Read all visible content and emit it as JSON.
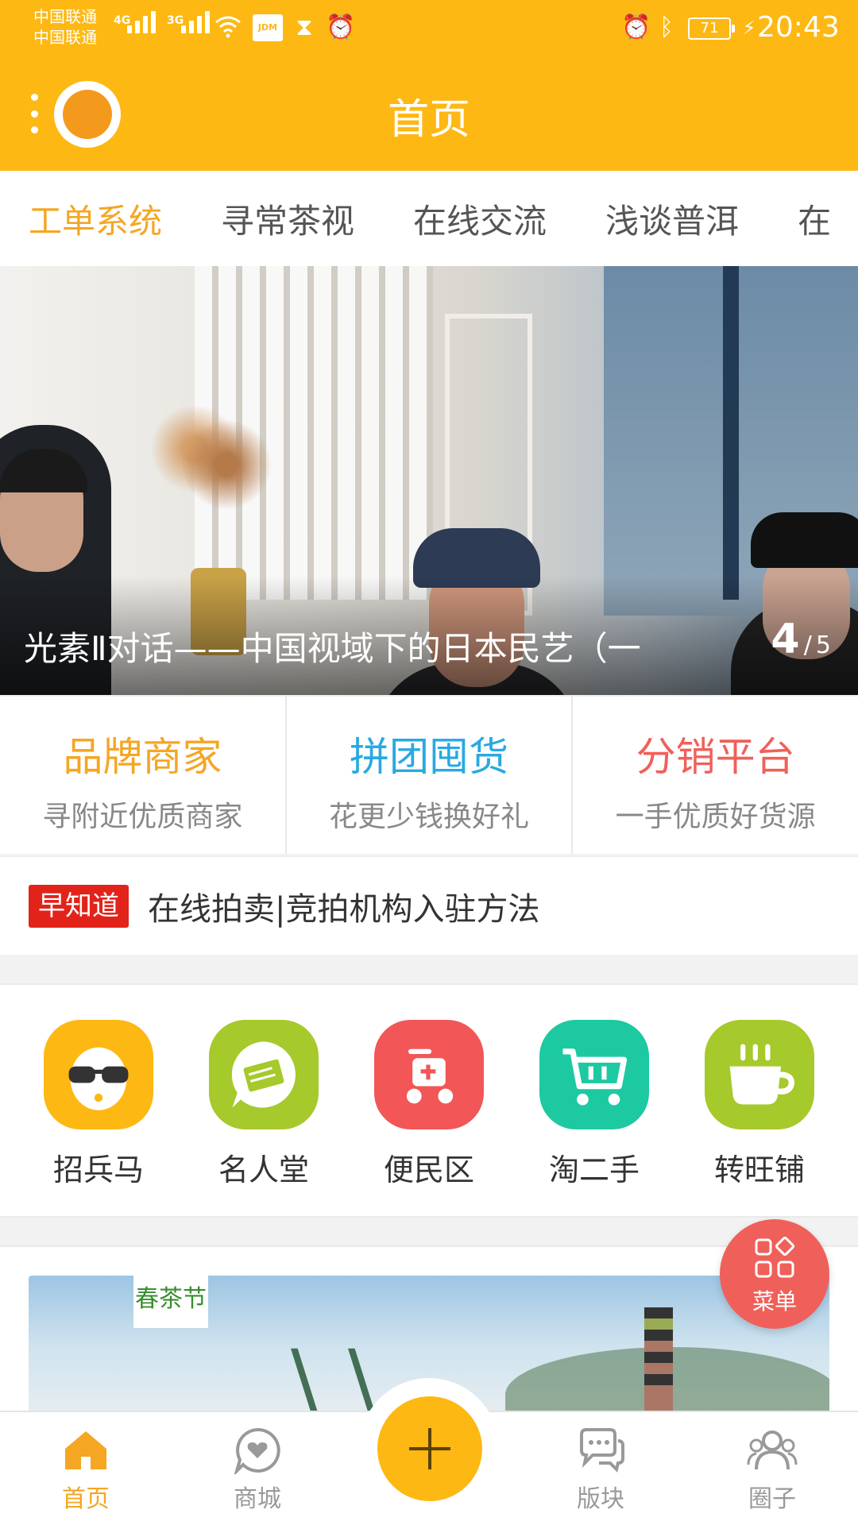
{
  "status_bar": {
    "carrier1": "中国联通",
    "carrier2": "中国联通",
    "net1": "4G",
    "net2": "3G",
    "jdm": "JDM",
    "battery": "71",
    "time": "20:43"
  },
  "header": {
    "title": "首页",
    "accent_color": "#FDB813"
  },
  "tabs": [
    "工单系统",
    "寻常茶视",
    "在线交流",
    "浅谈普洱",
    "在"
  ],
  "hero": {
    "caption": "光素Ⅱ对话——中国视域下的日本民艺（一",
    "current": "4",
    "separator": "/",
    "total": "5"
  },
  "promos": [
    {
      "title": "品牌商家",
      "subtitle": "寻附近优质商家",
      "color": "#F5A623"
    },
    {
      "title": "拼团囤货",
      "subtitle": "花更少钱换好礼",
      "color": "#29A9E1"
    },
    {
      "title": "分销平台",
      "subtitle": "一手优质好货源",
      "color": "#F0605A"
    }
  ],
  "ticker": {
    "badge": "早知道",
    "text": "在线拍卖|竞拍机构入驻方法"
  },
  "quick_icons": [
    {
      "label": "招兵马",
      "icon": "sunglasses-face-icon",
      "color": "#FDB813"
    },
    {
      "label": "名人堂",
      "icon": "chat-ticket-icon",
      "color": "#A6C92B"
    },
    {
      "label": "便民区",
      "icon": "scooter-icon",
      "color": "#F25656"
    },
    {
      "label": "淘二手",
      "icon": "cart-icon",
      "color": "#1DC9A0"
    },
    {
      "label": "转旺铺",
      "icon": "coffee-cup-icon",
      "color": "#A6C92B"
    }
  ],
  "banner": {
    "logo_text": "春茶节"
  },
  "fab": {
    "label": "菜单"
  },
  "bottom_nav": [
    {
      "label": "首页",
      "icon": "home-icon",
      "active": true
    },
    {
      "label": "商城",
      "icon": "heart-bubble-icon",
      "active": false
    },
    {
      "label": "",
      "icon": "plus-icon",
      "active": false
    },
    {
      "label": "版块",
      "icon": "chat-bubbles-icon",
      "active": false
    },
    {
      "label": "圈子",
      "icon": "people-icon",
      "active": false
    }
  ]
}
